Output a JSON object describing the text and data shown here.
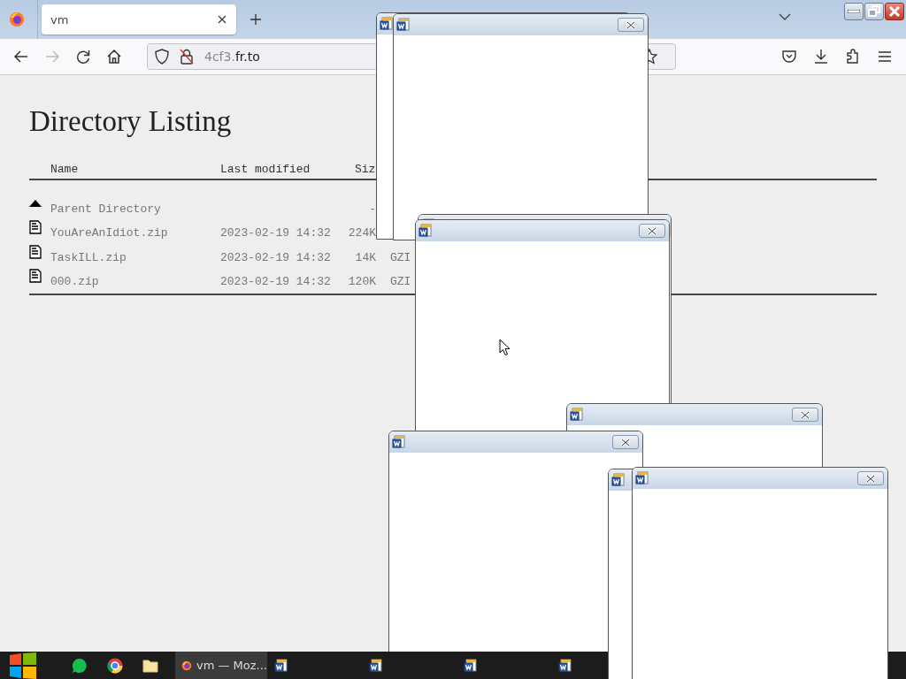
{
  "browser": {
    "tabs": [
      {
        "title": "vm",
        "selected": true
      }
    ],
    "url": {
      "subdomain": "4cf3.",
      "domain": "fr.to"
    },
    "forward_disabled": true
  },
  "page": {
    "heading": "Directory Listing",
    "columns": [
      "Name",
      "Last modified",
      "Siz"
    ],
    "rows": [
      {
        "kind": "parent",
        "name": "Parent Directory",
        "size": "-"
      },
      {
        "kind": "file",
        "name": "YouAreAnIdiot.zip",
        "modified": "2023-02-19 14:32",
        "size": "224K"
      },
      {
        "kind": "file",
        "name": "TaskILL.zip",
        "modified": "2023-02-19 14:32",
        "size": "14K",
        "type": "GZI"
      },
      {
        "kind": "file",
        "name": "000.zip",
        "modified": "2023-02-19 14:32",
        "size": "120K",
        "type": "GZI"
      }
    ]
  },
  "popup_windows": [
    {
      "kind": "document-window"
    },
    {
      "kind": "document-window"
    },
    {
      "kind": "document-window"
    },
    {
      "kind": "document-window"
    },
    {
      "kind": "document-window"
    },
    {
      "kind": "document-window"
    },
    {
      "kind": "document-window"
    },
    {
      "kind": "document-window"
    }
  ],
  "taskbar": {
    "items": [
      {
        "kind": "start"
      },
      {
        "kind": "music"
      },
      {
        "kind": "web"
      },
      {
        "kind": "files"
      },
      {
        "kind": "browser",
        "label": "vm — Moz...",
        "selected": true
      },
      {
        "kind": "document",
        "selected": false
      },
      {
        "kind": "document",
        "selected": false
      },
      {
        "kind": "document",
        "selected": false
      },
      {
        "kind": "document",
        "selected": false
      }
    ]
  }
}
